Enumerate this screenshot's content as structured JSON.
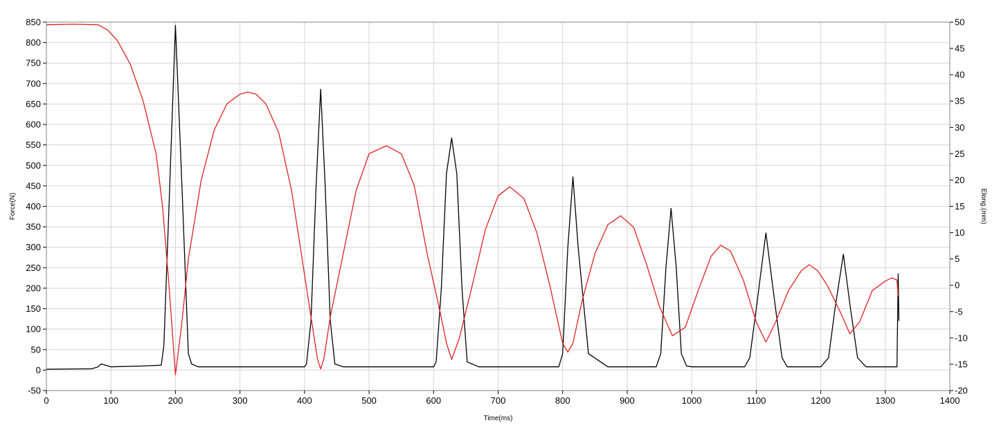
{
  "chart_data": {
    "type": "line",
    "xlabel": "Time(ms)",
    "ylabel": "Force(N)",
    "y2label": "Elong.(mm)",
    "xlim": [
      0,
      1400
    ],
    "ylim": [
      -50,
      850
    ],
    "y2lim": [
      -20,
      50
    ],
    "x_ticks": [
      0,
      100,
      200,
      300,
      400,
      500,
      600,
      700,
      800,
      900,
      1000,
      1100,
      1200,
      1300,
      1400
    ],
    "y_ticks": [
      -50,
      0,
      50,
      100,
      150,
      200,
      250,
      300,
      350,
      400,
      450,
      500,
      550,
      600,
      650,
      700,
      750,
      800,
      850
    ],
    "y2_ticks": [
      -20,
      -15,
      -10,
      -5,
      0,
      5,
      10,
      15,
      20,
      25,
      30,
      35,
      40,
      45,
      50
    ],
    "grid": true,
    "colors": {
      "force": "#000000",
      "elongation": "#e02020",
      "grid": "#d4d4d4"
    },
    "series": [
      {
        "axis": "left",
        "color": "#000000",
        "x": [
          0,
          70,
          80,
          85,
          100,
          150,
          178,
          182,
          190,
          200,
          210,
          220,
          225,
          235,
          260,
          300,
          350,
          400,
          403,
          410,
          418,
          425,
          432,
          440,
          447,
          460,
          500,
          550,
          600,
          604,
          612,
          620,
          628,
          636,
          644,
          652,
          670,
          700,
          750,
          794,
          800,
          808,
          816,
          824,
          840,
          870,
          900,
          945,
          952,
          960,
          968,
          976,
          984,
          992,
          1000,
          1050,
          1082,
          1090,
          1100,
          1115,
          1130,
          1140,
          1148,
          1170,
          1200,
          1212,
          1222,
          1235,
          1246,
          1257,
          1270,
          1280,
          1300,
          1318,
          1319,
          1320,
          1321
        ],
        "y": [
          2,
          3,
          8,
          15,
          8,
          10,
          12,
          60,
          400,
          842,
          450,
          40,
          15,
          8,
          8,
          8,
          8,
          8,
          15,
          120,
          450,
          686,
          450,
          120,
          15,
          8,
          8,
          8,
          8,
          20,
          200,
          480,
          567,
          480,
          200,
          20,
          8,
          8,
          8,
          8,
          40,
          300,
          472,
          300,
          40,
          8,
          8,
          8,
          40,
          250,
          395,
          250,
          40,
          10,
          8,
          8,
          8,
          30,
          150,
          335,
          150,
          30,
          8,
          8,
          8,
          30,
          150,
          283,
          150,
          30,
          8,
          8,
          8,
          8,
          120,
          235,
          120
        ]
      },
      {
        "axis": "right",
        "color": "#e02020",
        "x": [
          0,
          40,
          80,
          95,
          110,
          130,
          150,
          170,
          180,
          190,
          200,
          210,
          220,
          240,
          260,
          280,
          300,
          312,
          325,
          340,
          360,
          380,
          400,
          410,
          420,
          425,
          430,
          440,
          460,
          480,
          500,
          527,
          550,
          570,
          590,
          610,
          620,
          628,
          640,
          660,
          680,
          700,
          718,
          740,
          760,
          780,
          800,
          808,
          816,
          830,
          850,
          870,
          890,
          910,
          930,
          950,
          970,
          990,
          1010,
          1030,
          1045,
          1060,
          1080,
          1100,
          1115,
          1130,
          1150,
          1170,
          1182,
          1195,
          1210,
          1230,
          1245,
          1260,
          1280,
          1300,
          1310,
          1318,
          1320
        ],
        "y": [
          49.5,
          49.6,
          49.5,
          48.5,
          46.5,
          42,
          35,
          25,
          15,
          0,
          -17,
          -7,
          5,
          20,
          29.5,
          34.5,
          36.3,
          36.7,
          36.3,
          34.5,
          29,
          18,
          2,
          -6,
          -14,
          -15.9,
          -14,
          -6,
          6,
          18,
          25,
          26.5,
          25,
          19,
          6,
          -5,
          -11,
          -14.1,
          -10,
          0,
          10.5,
          17,
          18.7,
          16.5,
          10,
          0,
          -11,
          -12.7,
          -11,
          -3,
          6,
          11.5,
          13.2,
          11,
          4,
          -4,
          -9.6,
          -8,
          -1,
          5.5,
          7.6,
          6.5,
          1,
          -7,
          -10.8,
          -7,
          -1,
          2.8,
          3.9,
          2.8,
          0,
          -5,
          -9.2,
          -7,
          -1,
          0.8,
          1.4,
          1,
          -2
        ]
      }
    ]
  }
}
